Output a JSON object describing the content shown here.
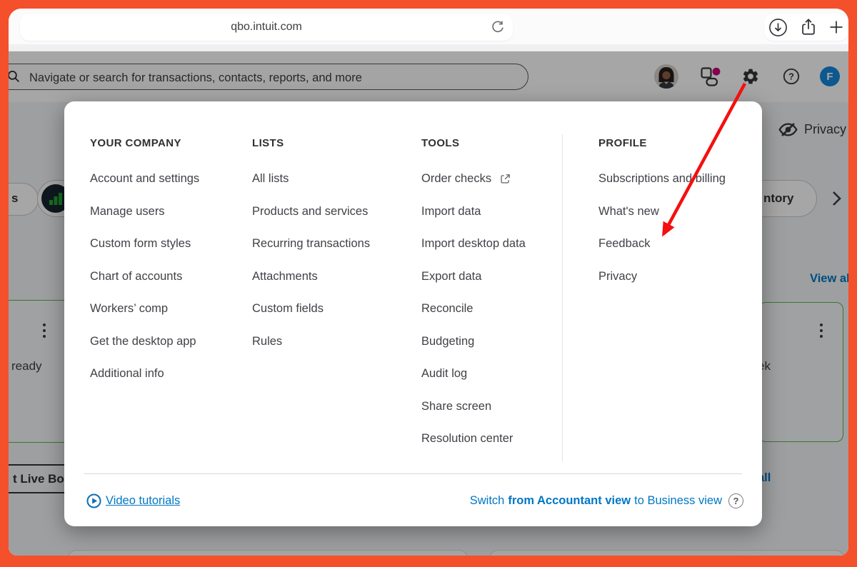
{
  "browser": {
    "url": "qbo.intuit.com"
  },
  "header": {
    "search_placeholder": "Navigate or search for transactions, contacts, reports, and more",
    "profile_initial": "F"
  },
  "menu": {
    "columns": [
      {
        "title": "YOUR COMPANY",
        "items": [
          "Account and settings",
          "Manage users",
          "Custom form styles",
          "Chart of accounts",
          "Workers’ comp",
          "Get the desktop app",
          "Additional info"
        ]
      },
      {
        "title": "LISTS",
        "items": [
          "All lists",
          "Products and services",
          "Recurring transactions",
          "Attachments",
          "Custom fields",
          "Rules"
        ]
      },
      {
        "title": "TOOLS",
        "items": [
          "Order checks",
          "Import data",
          "Import desktop data",
          "Export data",
          "Reconcile",
          "Budgeting",
          "Audit log",
          "Share screen",
          "Resolution center"
        ]
      },
      {
        "title": "PROFILE",
        "items": [
          "Subscriptions and billing",
          "What's new",
          "Feedback",
          "Privacy"
        ]
      }
    ],
    "footer": {
      "video_tutorials": "Video tutorials",
      "switch_prefix": "Switch",
      "switch_bold": "from Accountant view",
      "switch_suffix": "to Business view"
    }
  },
  "dashboard": {
    "privacy_label": "Privacy",
    "pill_left_fragment": "s",
    "pill_right_fragment": "ntory",
    "view_all_top": "View all",
    "card_left_fragment": "ready",
    "card_right_fragment": "ek",
    "live_bookkeeping_fragment": "t Live Boo",
    "view_all_bottom_fragment": "all"
  },
  "colors": {
    "accent_orange": "#F4502B",
    "link_blue": "#0077C5",
    "card_green": "#58B552",
    "arrow_red": "#F50F0F",
    "badge_magenta": "#C9007A",
    "avatar_blue": "#1588DB",
    "text_dark": "#393A3D"
  }
}
